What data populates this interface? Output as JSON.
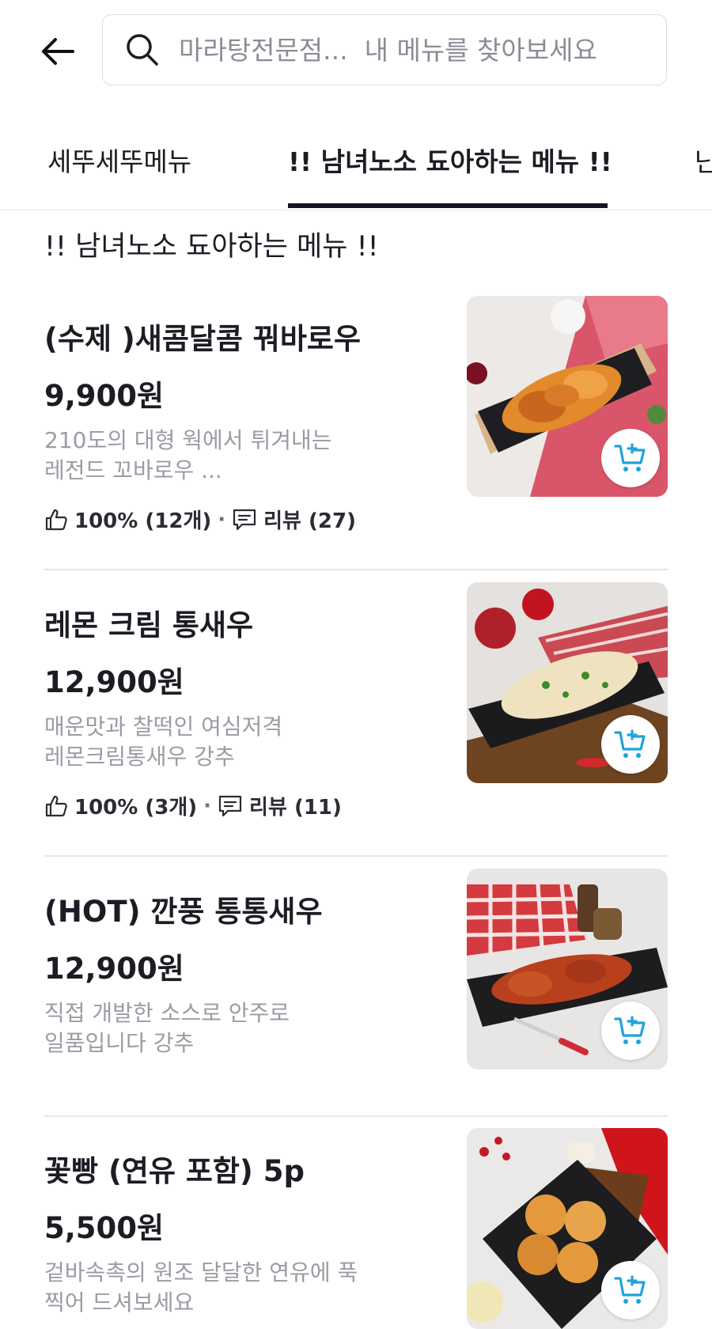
{
  "header": {
    "search_placeholder": "마라탕전문점...  내 메뉴를 찾아보세요"
  },
  "tabs": [
    {
      "label": "세뚜세뚜메뉴",
      "active": false
    },
    {
      "label": "!! 남녀노소 됴아하는 메뉴 !!",
      "active": true
    },
    {
      "label": "난",
      "active": false
    }
  ],
  "section": {
    "title": "!! 남녀노소 됴아하는 메뉴 !!"
  },
  "items": [
    {
      "name": "(수제 )새콤달콤 꿔바로우",
      "price": "9,900원",
      "desc_line1": "210도의 대형 웍에서 튀겨내는",
      "desc_line2": "레전드 꼬바로우 ...",
      "likes": "100% (12개)",
      "reviews": "리뷰 (27)"
    },
    {
      "name": "레몬 크림 통새우",
      "price": "12,900원",
      "desc_line1": "매운맛과 찰떡인 여심저격",
      "desc_line2": "레몬크림통새우 강추",
      "likes": "100% (3개)",
      "reviews": "리뷰 (11)"
    },
    {
      "name": "(HOT) 깐풍 통통새우",
      "price": "12,900원",
      "desc_line1": "직접 개발한 소스로 안주로",
      "desc_line2": "일품입니다 강추"
    },
    {
      "name": "꽃빵 (연유 포함) 5p",
      "price": "5,500원",
      "desc_line1": "겉바속촉의 원조 달달한 연유에 푹",
      "desc_line2": "찍어 드셔보세요"
    }
  ],
  "icons": {
    "back": "arrow-left-icon",
    "search": "search-icon",
    "like": "thumbs-up-icon",
    "review": "comment-icon",
    "cart": "cart-add-icon"
  },
  "colors": {
    "accent": "#1fa3dc",
    "text": "#1c1d24",
    "muted": "#9a9ca4",
    "tab_indicator": "#141428"
  }
}
